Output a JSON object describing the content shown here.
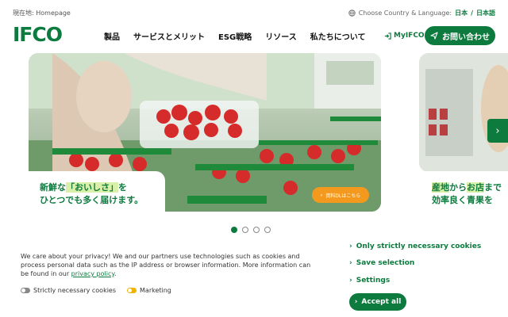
{
  "breadcrumb": {
    "label": "現在地:",
    "page": "Homepage"
  },
  "language": {
    "label": "Choose Country & Language:",
    "current": "日本",
    "separator": "/",
    "lang": "日本語"
  },
  "logo": "IFCO",
  "nav": [
    "製品",
    "サービスとメリット",
    "ESG戦略",
    "リソース",
    "私たちについて"
  ],
  "myifco": "MyIFCO",
  "contact_label": "お問い合わせ",
  "hero": {
    "caption_l1_pre": "新鮮な",
    "caption_l1_hl": "「おいしさ」",
    "caption_l1_post": "を",
    "caption_l2": "ひとつでも多く届けます。",
    "download_label": "資料DLはこちら"
  },
  "hero_next": {
    "l1_a": "産地",
    "l1_b": "から",
    "l1_c": "お店",
    "l1_d": "まで",
    "l2": "効率良く青果を"
  },
  "carousel": {
    "count": 4,
    "active": 0
  },
  "cookie": {
    "text": "We care about your privacy! We and our partners use technologies such as cookies and process personal data such as the IP address or browser information. More information can be found in our",
    "link": "privacy policy",
    "link_suffix": ".",
    "toggle_necessary": "Strictly necessary cookies",
    "toggle_marketing": "Marketing",
    "only_necessary": "Only strictly necessary cookies",
    "save_selection": "Save selection",
    "settings": "Settings",
    "accept_all": "Accept all"
  },
  "colors": {
    "brand": "#0d7a3e",
    "accent": "#f39a1e",
    "highlight": "#d9f0a8"
  }
}
